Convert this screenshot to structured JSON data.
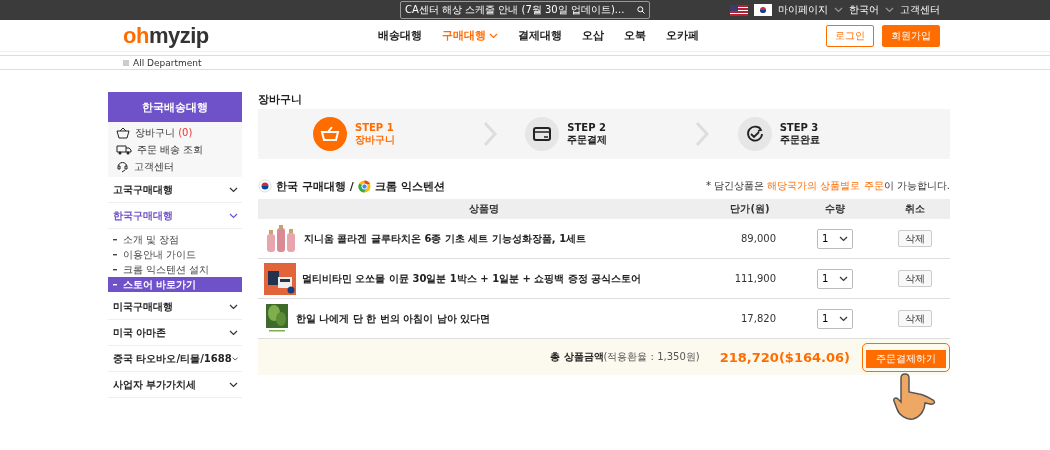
{
  "top_bar": {
    "notice": "CA센터 해상 스케줄 안내 (7월 30일 업데이트)...",
    "links": [
      {
        "label": "마이페이지",
        "dropdown": true
      },
      {
        "label": "한국어",
        "dropdown": true
      },
      {
        "label": "고객센터",
        "dropdown": false
      }
    ]
  },
  "header": {
    "logo": {
      "accent": "oh",
      "rest": "myzip"
    },
    "nav": [
      {
        "label": "배송대행",
        "selected": false,
        "dropdown": false
      },
      {
        "label": "구매대행",
        "selected": true,
        "dropdown": true
      },
      {
        "label": "결제대행",
        "selected": false,
        "dropdown": false
      },
      {
        "label": "오삽",
        "selected": false,
        "dropdown": false
      },
      {
        "label": "오북",
        "selected": false,
        "dropdown": false
      },
      {
        "label": "오카페",
        "selected": false,
        "dropdown": false
      }
    ],
    "login": "로그인",
    "signup": "회원가입"
  },
  "breadcrumb": "All Department",
  "sidebar": {
    "title": "한국배송대행",
    "quick_links": [
      {
        "kind": "basket",
        "label": "장바구니",
        "count": "(0)"
      },
      {
        "kind": "truck",
        "label": "주문 배송 조회"
      },
      {
        "kind": "support",
        "label": "고객센터"
      }
    ],
    "menu": [
      {
        "label": "고국구매대행",
        "selected": false
      },
      {
        "label": "한국구매대행",
        "selected": true,
        "children": [
          {
            "label": "소개 및 장점",
            "selected": false
          },
          {
            "label": "이용안내 가이드",
            "selected": false
          },
          {
            "label": "크롬 익스텐션 설치",
            "selected": false
          },
          {
            "label": "스토어 바로가기",
            "selected": true
          }
        ]
      },
      {
        "label": "미국구매대행",
        "selected": false
      },
      {
        "label": "미국 아마존",
        "selected": false
      },
      {
        "label": "중국 타오바오/티몰/1688",
        "selected": false
      },
      {
        "label": "사업자 부가가치세",
        "selected": false
      }
    ]
  },
  "main": {
    "title": "장바구니",
    "steps": [
      {
        "kind": "basket",
        "step": "STEP 1",
        "label": "장바구니",
        "selected": true
      },
      {
        "kind": "card",
        "step": "STEP 2",
        "label": "주문결제",
        "selected": false
      },
      {
        "kind": "check",
        "step": "STEP 3",
        "label": "주문완료",
        "selected": false
      }
    ],
    "section": {
      "title": "한국 구매대행 /",
      "subtitle": "크롬 익스텐션",
      "note": {
        "before": "* 담긴상품은 ",
        "highlight": "해당국가의 상품별로 주문",
        "after": "이 가능합니다."
      }
    },
    "table": {
      "columns": [
        "상품명",
        "단가(원)",
        "수량",
        "취소"
      ],
      "rows": [
        {
          "kind": "bottles",
          "name": "지니움 콜라겐 글루타치온 6종 기초 세트 기능성화장품, 1세트",
          "price": "89,000",
          "qty": "1",
          "delete": "삭제"
        },
        {
          "kind": "box",
          "name": "멀티비타민 오쏘몰 이뮨 30일분 1박스 + 1일분 + 쇼핑백 증정 공식스토어",
          "price": "111,900",
          "qty": "1",
          "delete": "삭제"
        },
        {
          "kind": "book",
          "name": "한일 나에게 단 한 번의 아침이 남아 있다면",
          "price": "17,820",
          "qty": "1",
          "delete": "삭제"
        }
      ]
    },
    "total": {
      "label": "총 상품금액",
      "rate": "(적용환율 : 1,350원)",
      "amount": "218,720",
      "usd": "($164.06)",
      "order_button": "주문결제하기"
    }
  }
}
